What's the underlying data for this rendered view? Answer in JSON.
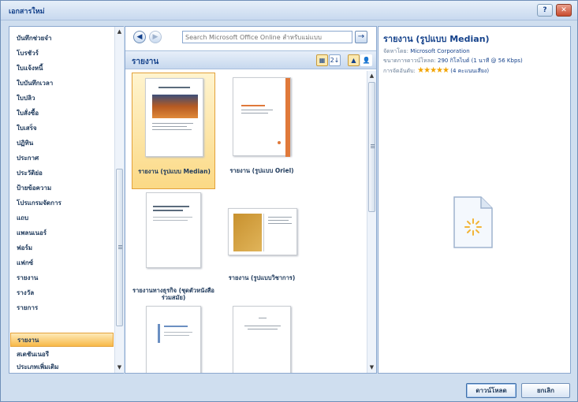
{
  "window": {
    "title": "เอกสารใหม่",
    "help_label": "?",
    "close_label": "✕"
  },
  "categories": [
    {
      "label": "บันทึกช่วยจำ"
    },
    {
      "label": "โบรชัวร์"
    },
    {
      "label": "ใบแจ้งหนี้"
    },
    {
      "label": "ใบบันทึกเวลา"
    },
    {
      "label": "ใบปลิว"
    },
    {
      "label": "ใบสั่งซื้อ"
    },
    {
      "label": "ใบเสร็จ"
    },
    {
      "label": "ปฏิทิน"
    },
    {
      "label": "ประกาศ"
    },
    {
      "label": "ประวัติย่อ"
    },
    {
      "label": "ป้ายข้อความ"
    },
    {
      "label": "โปรแกรมจัดการ"
    },
    {
      "label": "แถบ"
    },
    {
      "label": "แพลนเนอร์"
    },
    {
      "label": "ฟอร์ม"
    },
    {
      "label": "แฟกซ์"
    },
    {
      "label": "รายงาน"
    },
    {
      "label": "รางวัล"
    },
    {
      "label": "รายการ"
    },
    {
      "label": "รายงาน",
      "selected": true
    },
    {
      "label": "สเตชันเนอรี"
    },
    {
      "label": "ประเภทเพิ่มเติม"
    }
  ],
  "search": {
    "placeholder": "Search Microsoft Office Online สำหรับแม่แบบ",
    "back_label": "◀",
    "forward_label": "▶",
    "go_label": "→"
  },
  "section": {
    "title": "รายงาน",
    "view_icons": [
      "▦",
      "2↓",
      "▲",
      "👤"
    ]
  },
  "templates": [
    {
      "label": "รายงาน (รูปแบบ Median)",
      "selected": true
    },
    {
      "label": "รายงาน (รูปแบบ Oriel)"
    },
    {
      "label": "รายงานทางธุรกิจ (ชุดตัวหนังสือร่วมสมัย)"
    },
    {
      "label": "รายงาน (รูปแบบวิชาการ)"
    },
    {
      "label": ""
    },
    {
      "label": ""
    }
  ],
  "preview": {
    "title": "รายงาน (รูปแบบ Median)",
    "provider_label": "จัดหาโดย:",
    "provider": "Microsoft Corporation",
    "size_label": "ขนาดการดาวน์โหลด:",
    "size": "290 กิโลไบต์ (1 นาที @ 56 Kbps)",
    "rating_label": "การจัดอันดับ:",
    "stars": "★★★★★",
    "votes": "(4 คะแนนเสียง)",
    "icon": "document-loading-icon"
  },
  "buttons": {
    "download": "ดาวน์โหลด",
    "cancel": "ยกเลิก"
  },
  "colors": {
    "accent": "#15428b",
    "selection": "#fbd985",
    "frame": "#cfdeef"
  }
}
